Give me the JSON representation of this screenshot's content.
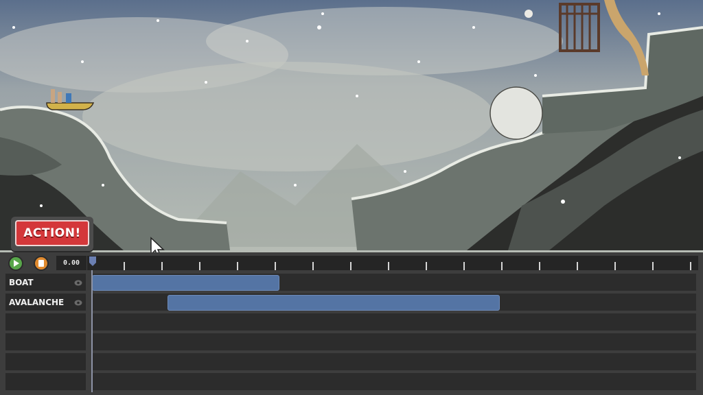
{
  "action_button": {
    "label": "ACTION!"
  },
  "toolbar": {
    "play_icon": "play-icon",
    "stop_icon": "stop-icon",
    "time": "0.00",
    "play_color": "#58a64a",
    "stop_color": "#e08a2e"
  },
  "tracks": [
    {
      "name": "BOAT",
      "clip_start": 0.0,
      "clip_end": 0.31
    },
    {
      "name": "AVALANCHE",
      "clip_start": 0.125,
      "clip_end": 0.675
    },
    {
      "name": ""
    },
    {
      "name": ""
    },
    {
      "name": ""
    },
    {
      "name": ""
    }
  ],
  "colors": {
    "clip": "#5474a4",
    "action_red": "#d4373a"
  }
}
